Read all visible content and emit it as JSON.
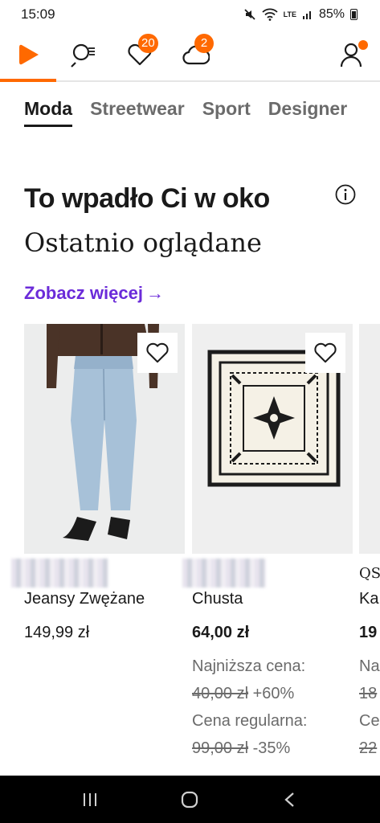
{
  "status_bar": {
    "time": "15:09",
    "network": "LTE",
    "battery": "85%"
  },
  "top_nav": {
    "favorites_badge": "20",
    "notifications_badge": "2"
  },
  "categories": [
    "Moda",
    "Streetwear",
    "Sport",
    "Designer"
  ],
  "section": {
    "title": "To wpadło Ci w oko",
    "subtitle": "Ostatnio oglądane",
    "see_more": "Zobacz więcej",
    "see_more_arrow": "→"
  },
  "products": [
    {
      "name": "Jeansy Zwężane",
      "price": "149,99 zł"
    },
    {
      "name": "Chusta",
      "price": "64,00 zł",
      "lowest_label": "Najniższa cena:",
      "lowest_price": "40,00 zł",
      "lowest_change": "+60%",
      "regular_label": "Cena regularna:",
      "regular_price": "99,00 zł",
      "regular_change": "-35%"
    },
    {
      "brand": "QS",
      "name": "Ka",
      "price": "19",
      "line1": "Na",
      "line2": "18",
      "line3": "Ce",
      "line4": "22"
    }
  ],
  "colors": {
    "accent": "#ff6900",
    "link": "#6b2bd9"
  }
}
